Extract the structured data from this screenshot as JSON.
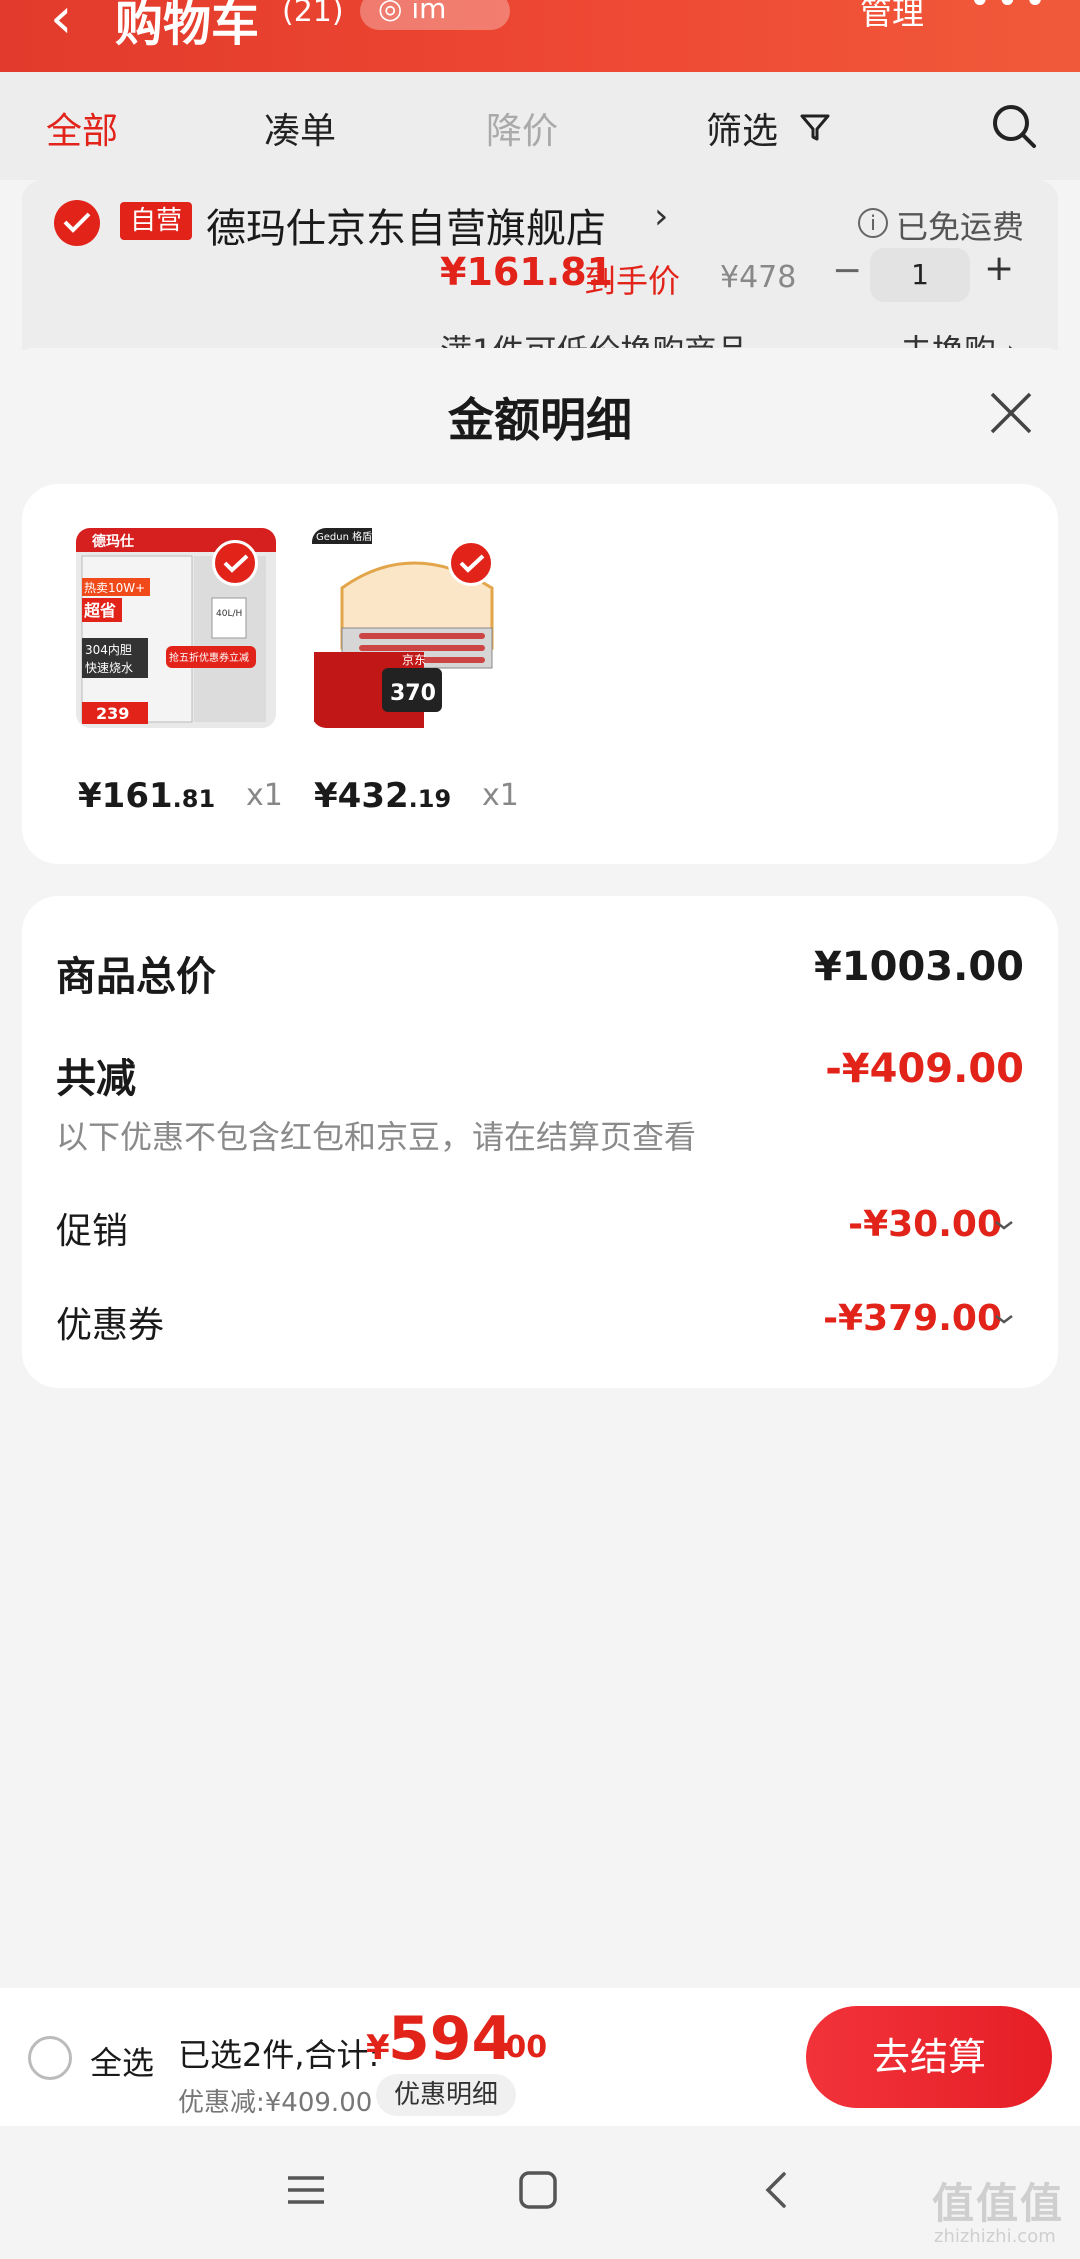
{
  "background": {
    "title": "购物车",
    "count": "(21)",
    "location": "im",
    "manage": "管理",
    "more": "•••",
    "tabs": [
      "全部",
      "凑单",
      "降价",
      "筛选"
    ],
    "store": {
      "badge": "自营",
      "name": "德玛仕京东自营旗舰店",
      "free_shipping": "已免运费",
      "price": "¥161.81",
      "price_tag": "到手价",
      "orig_price": "¥478",
      "minus": "−",
      "qty": "1",
      "plus": "+",
      "exchange": "满1件可低价换购商品",
      "exchange_go": "去换购 ›"
    }
  },
  "sheet": {
    "title": "金额明细",
    "products": [
      {
        "price_int": "¥161",
        "price_dec": ".81",
        "qty": "x1",
        "brand": "德玛仕",
        "badge1": "热卖10W+",
        "badge2": "超省",
        "spec1": "304内胆",
        "spec2": "快速烧水",
        "price_tag": "239",
        "capacity": "40L/H",
        "promo": "抢五折优惠券立减"
      },
      {
        "price_int": "¥432",
        "price_dec": ".19",
        "qty": "x1",
        "brand": "Gedun 格盾",
        "price_tag": "370",
        "promo": "京东"
      }
    ],
    "summary": {
      "total_label": "商品总价",
      "total_value": "¥1003.00",
      "reduce_label": "共减",
      "reduce_value": "-¥409.00",
      "note": "以下优惠不包含红包和京豆，请在结算页查看",
      "promo_label": "促销",
      "promo_value": "-¥30.00",
      "coupon_label": "优惠券",
      "coupon_value": "-¥379.00"
    }
  },
  "checkout": {
    "select_all": "全选",
    "selected": "已选2件,合计:",
    "currency": "¥",
    "total_int": "594",
    "total_dec": ".00",
    "discount": "优惠减:¥409.00",
    "detail": "优惠明细",
    "button": "去结算"
  },
  "watermark": {
    "main": "值值值",
    "sub": "zhizhizhi.com"
  },
  "colors": {
    "accent": "#e2231a",
    "sheet_bg": "#f4f4f4"
  }
}
